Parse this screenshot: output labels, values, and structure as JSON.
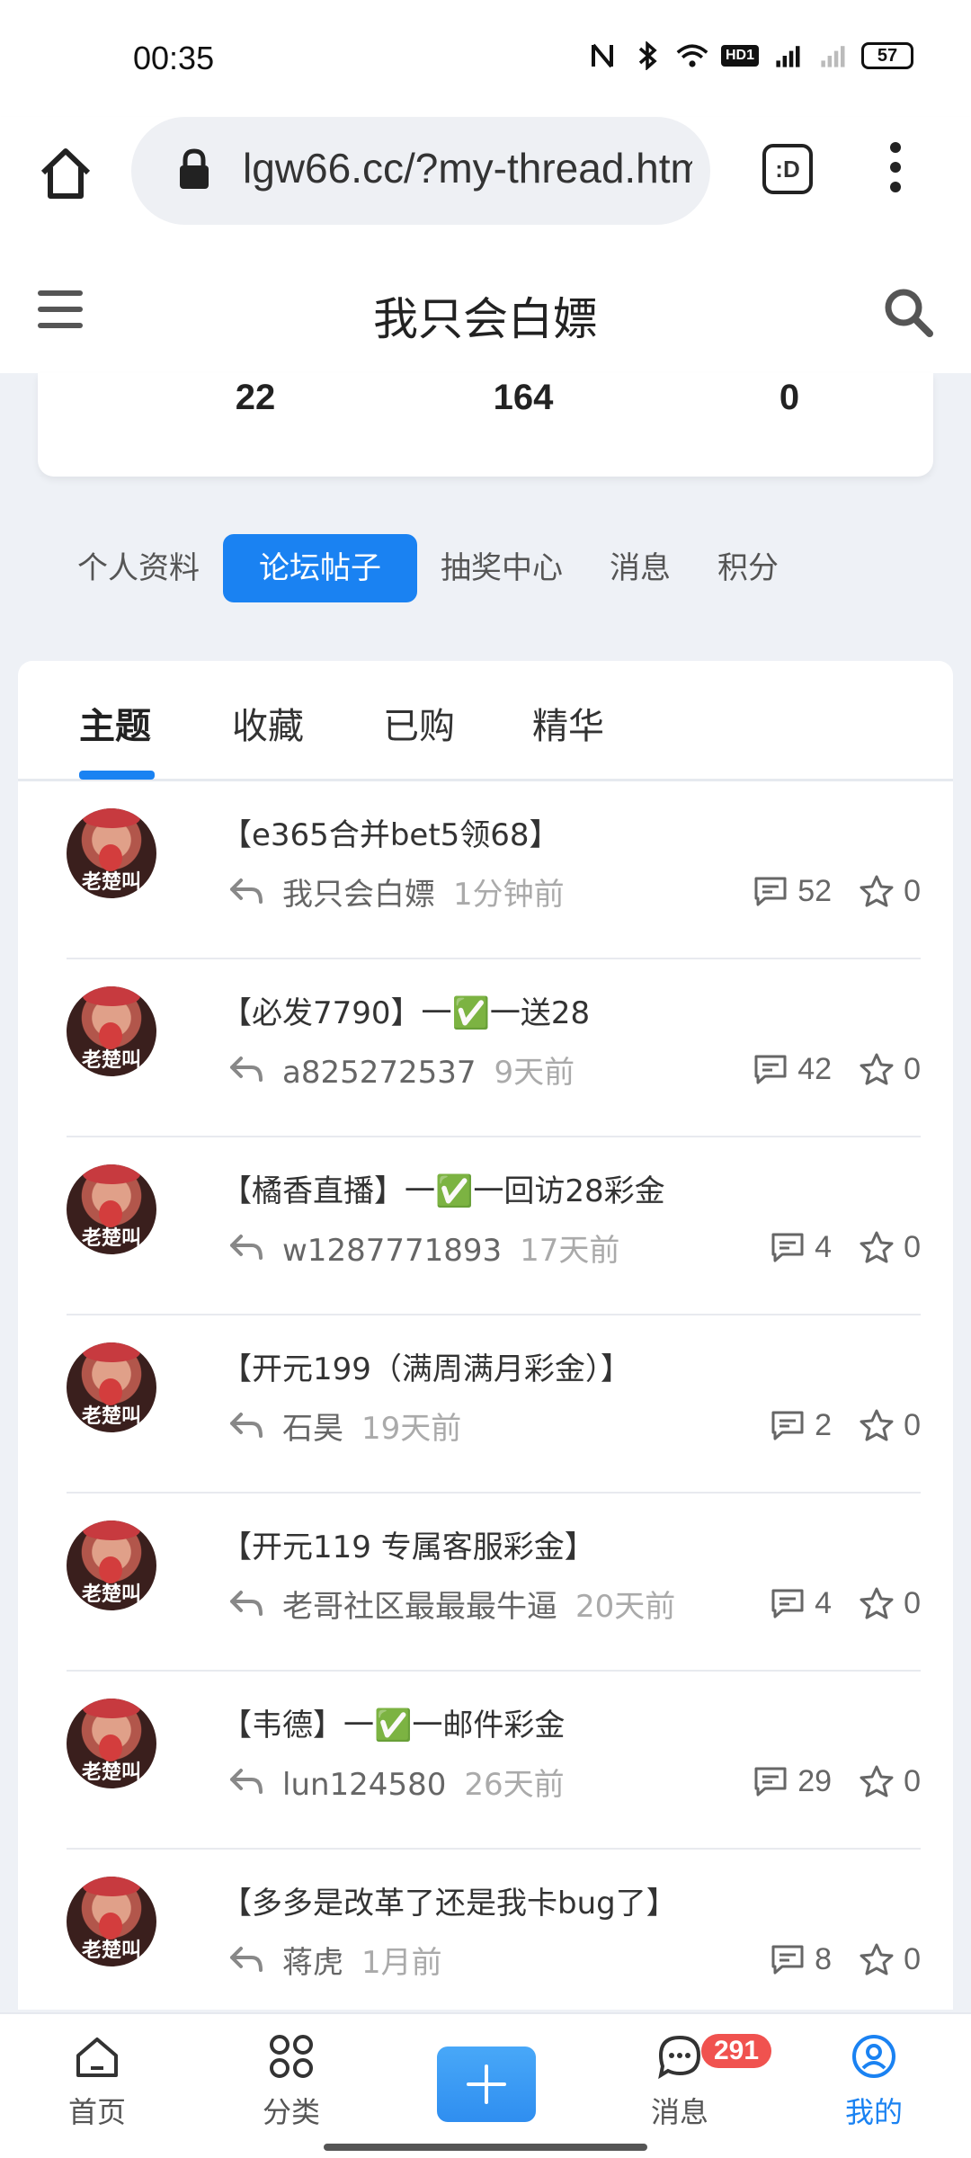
{
  "status_bar": {
    "time": "00:35",
    "battery": "57",
    "network_label": "HD1",
    "signal_label": "4G"
  },
  "browser": {
    "url": "lgw66.cc/?my-thread.htm",
    "tab_label": ":D"
  },
  "site": {
    "title": "我只会白嫖"
  },
  "stats": [
    "22",
    "164",
    "0"
  ],
  "profile_nav": [
    "个人资料",
    "论坛帖子",
    "抽奖中心",
    "消息",
    "积分"
  ],
  "subtabs": [
    "主题",
    "收藏",
    "已购",
    "精华"
  ],
  "avatar_caption": "老楚叫",
  "posts": [
    {
      "title": "【e365合并bet5领68】",
      "author": "我只会白嫖",
      "time": "1分钟前",
      "comments": "52",
      "stars": "0"
    },
    {
      "title": "【必发7790】一✅一送28",
      "author": "a825272537",
      "time": "9天前",
      "comments": "42",
      "stars": "0"
    },
    {
      "title": "【橘香直播】一✅一回访28彩金",
      "author": "w1287771893",
      "time": "17天前",
      "comments": "4",
      "stars": "0"
    },
    {
      "title": "【开元199（满周满月彩金）】",
      "author": "石昊",
      "time": "19天前",
      "comments": "2",
      "stars": "0"
    },
    {
      "title": "【开元119 专属客服彩金】",
      "author": "老哥社区最最最牛逼",
      "time": "20天前",
      "comments": "4",
      "stars": "0"
    },
    {
      "title": "【韦德】一✅一邮件彩金",
      "author": "lun124580",
      "time": "26天前",
      "comments": "29",
      "stars": "0"
    },
    {
      "title": "【多多是改革了还是我卡bug了】",
      "author": "蒋虎",
      "time": "1月前",
      "comments": "8",
      "stars": "0"
    }
  ],
  "bottom_nav": {
    "home": "首页",
    "category": "分类",
    "messages": "消息",
    "mine": "我的",
    "badge": "291"
  },
  "colors": {
    "accent": "#1a82f2",
    "badge": "#f0524f"
  }
}
